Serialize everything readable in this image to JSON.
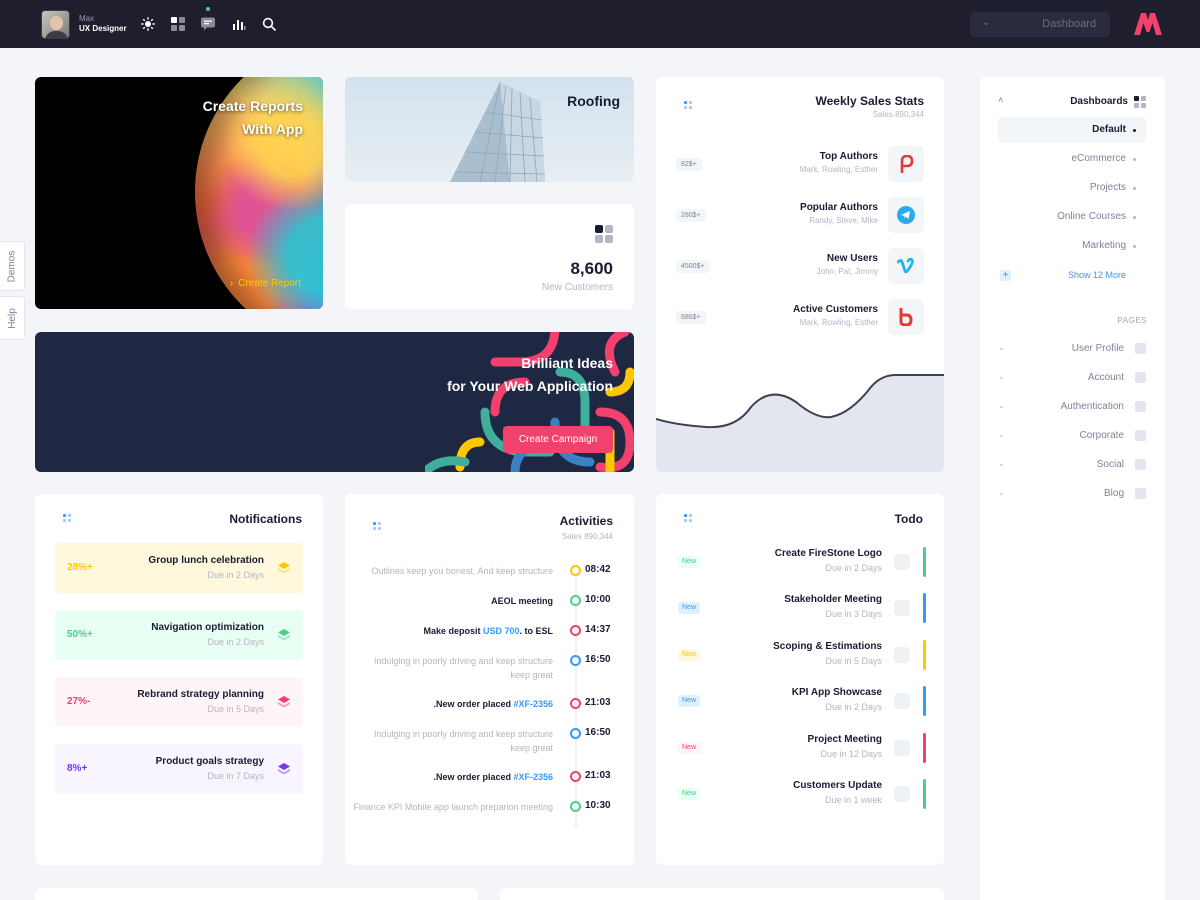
{
  "header": {
    "user_name": "Max",
    "user_role": "UX Designer",
    "icons": [
      "sun-icon",
      "layout-icon",
      "chat-icon",
      "stats-icon",
      "search-icon"
    ],
    "dashboard_select": "Dashboard",
    "colors": {
      "bar_bg": "#1e1e2d",
      "badge": "#50cd89",
      "logo": "#f1416c"
    }
  },
  "side_tabs": {
    "demos": "Demos",
    "help": "Help"
  },
  "reports": {
    "title_line1": "Create Reports",
    "title_line2": "With App",
    "link": "Create Report"
  },
  "roofing": {
    "title": "Roofing"
  },
  "customers": {
    "value": "8,600",
    "label": "New Customers"
  },
  "ideas": {
    "title_line1": "Brilliant Ideas",
    "title_line2": "for Your Web Application",
    "button": "Create Campaign"
  },
  "weekly": {
    "title": "Weekly Sales Stats",
    "subtitle": "Sales 890,344",
    "rows": [
      {
        "badge": "82$+",
        "name": "Top Authors",
        "people": "Mark, Rowling, Esther",
        "logo": "pinterest-like-icon",
        "color": "#e0383e"
      },
      {
        "badge": "280$+",
        "name": "Popular Authors",
        "people": "Randy, Steve, Mike",
        "logo": "telegram-icon",
        "color": "#2aabee"
      },
      {
        "badge": "4500$+",
        "name": "New Users",
        "people": "John, Pat, Jimmy",
        "logo": "vimeo-icon",
        "color": "#1ab7ea"
      },
      {
        "badge": "686$+",
        "name": "Active Customers",
        "people": "Mark, Rowling, Esther",
        "logo": "bebo-icon",
        "color": "#e53935"
      }
    ]
  },
  "aside": {
    "header": "Dashboards",
    "items": [
      {
        "label": "Default",
        "active": true
      },
      {
        "label": "eCommerce",
        "active": false
      },
      {
        "label": "Projects",
        "active": false
      },
      {
        "label": "Online Courses",
        "active": false
      },
      {
        "label": "Marketing",
        "active": false
      }
    ],
    "more": "Show 12 More",
    "section": "PAGES",
    "pages": [
      "User Profile",
      "Account",
      "Authentication",
      "Corporate",
      "Social",
      "Blog"
    ]
  },
  "notifications": {
    "title": "Notifications",
    "items": [
      {
        "pct": "28%+",
        "title": "Group lunch celebration",
        "due": "Due in 2 Days",
        "bg": "#fff8dd",
        "color": "#ffc700"
      },
      {
        "pct": "50%+",
        "title": "Navigation optimization",
        "due": "Due in 2 Days",
        "bg": "#e8fff3",
        "color": "#50cd89"
      },
      {
        "pct": "27%-",
        "title": "Rebrand strategy planning",
        "due": "Due in 5 Days",
        "bg": "#fff5f8",
        "color": "#f1416c"
      },
      {
        "pct": "8%+",
        "title": "Product goals strategy",
        "due": "Due in 7 Days",
        "bg": "#f8f5ff",
        "color": "#7239ea"
      }
    ]
  },
  "activities": {
    "title": "Activities",
    "subtitle": "Sales 890,344",
    "items": [
      {
        "time": "08:42",
        "text": "Outlines keep you honest. And keep structure",
        "bold": false,
        "color": "#ffc700"
      },
      {
        "time": "10:00",
        "text": "AEOL meeting",
        "bold": true,
        "color": "#50cd89"
      },
      {
        "time": "14:37",
        "pre": "Make deposit ",
        "hl": "USD 700",
        "post": ". to ESL",
        "bold": true,
        "color": "#f1416c"
      },
      {
        "time": "16:50",
        "text": "Indulging in poorly driving and keep structure keep great",
        "bold": false,
        "color": "#3699ff"
      },
      {
        "time": "21:03",
        "pre": ".New order placed ",
        "hl": "#XF-2356",
        "post": "",
        "bold": true,
        "color": "#f1416c"
      },
      {
        "time": "16:50",
        "text": "Indulging in poorly driving and keep structure keep great",
        "bold": false,
        "color": "#3699ff"
      },
      {
        "time": "21:03",
        "pre": ".New order placed ",
        "hl": "#XF-2356",
        "post": "",
        "bold": true,
        "color": "#f1416c"
      },
      {
        "time": "10:30",
        "text": "Finance KPI Mobile app launch preparion meeting",
        "bold": false,
        "color": "#50cd89"
      }
    ]
  },
  "todo": {
    "title": "Todo",
    "items": [
      {
        "tag": "New",
        "title": "Create FireStone Logo",
        "due": "Due in 2 Days",
        "color": "#50cd89",
        "tagbg": "#e8fff3"
      },
      {
        "tag": "New",
        "title": "Stakeholder Meeting",
        "due": "Due in 3 Days",
        "color": "#3699ff",
        "tagbg": "#e1f0ff"
      },
      {
        "tag": "New",
        "title": "Scoping & Estimations",
        "due": "Due in 5 Days",
        "color": "#ffc700",
        "tagbg": "#fff8dd"
      },
      {
        "tag": "New",
        "title": "KPI App Showcase",
        "due": "Due in 2 Days",
        "color": "#3699ff",
        "tagbg": "#e1f0ff"
      },
      {
        "tag": "New",
        "title": "Project Meeting",
        "due": "Due in 12 Days",
        "color": "#f1416c",
        "tagbg": "#fff5f8"
      },
      {
        "tag": "New",
        "title": "Customers Update",
        "due": "Due in 1 week",
        "color": "#50cd89",
        "tagbg": "#e8fff3"
      }
    ]
  }
}
